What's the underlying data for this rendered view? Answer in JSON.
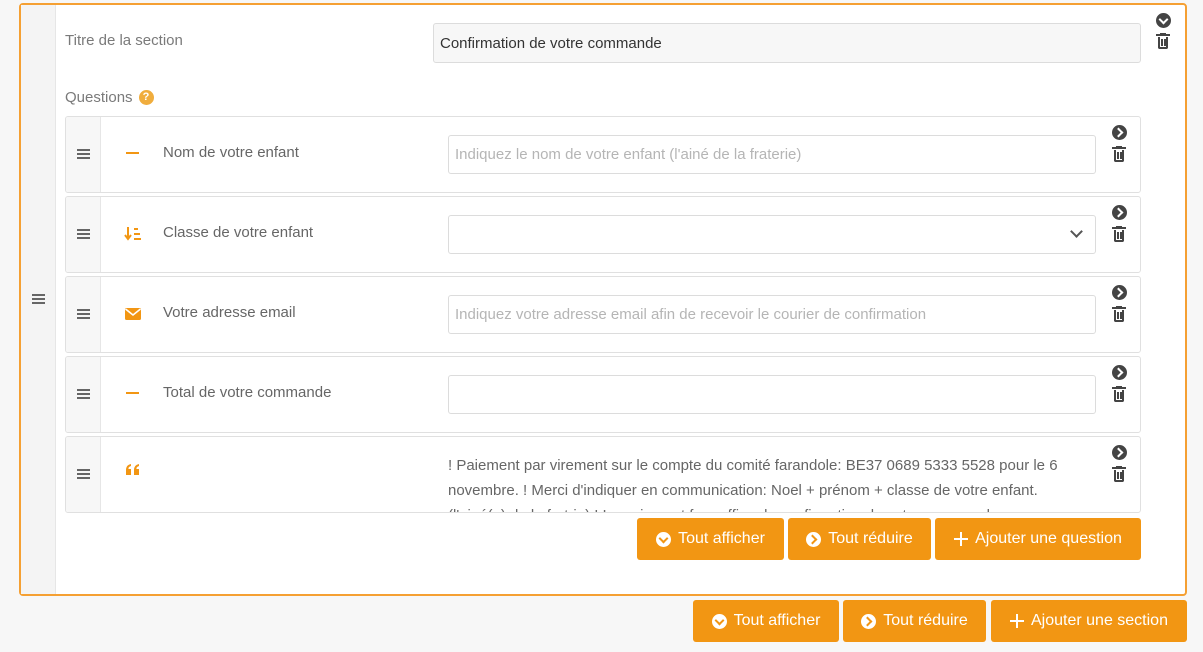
{
  "section": {
    "title_label": "Titre de la section",
    "title_value": "Confirmation de votre commande",
    "questions_label": "Questions",
    "help_icon": "?"
  },
  "questions": [
    {
      "label": "Nom de votre enfant",
      "type_icon": "minus-icon",
      "placeholder": "Indiquez le nom de votre enfant (l'ainé de la fraterie)",
      "value": ""
    },
    {
      "label": "Classe de votre enfant",
      "type_icon": "sort-list-icon",
      "value": ""
    },
    {
      "label": "Votre adresse email",
      "type_icon": "envelope-icon",
      "placeholder": "Indiquez votre adresse email afin de recevoir le courier de confirmation",
      "value": ""
    },
    {
      "label": "Total de votre commande",
      "type_icon": "minus-icon",
      "placeholder": "",
      "value": ""
    },
    {
      "label": "",
      "type_icon": "quote-icon",
      "text": "! Paiement par virement sur le compte du comité farandole: BE37 0689 5333 5528 pour le 6 novembre. ! Merci d'indiquer en communication: Noel + prénom + classe de votre enfant. (l'ainé(e) de la fratrie) ! Le paiement fera office de confirmation de votre commande."
    }
  ],
  "question_buttons": {
    "show_all": "Tout afficher",
    "collapse_all": "Tout réduire",
    "add_question": "Ajouter une question"
  },
  "section_buttons": {
    "show_all": "Tout afficher",
    "collapse_all": "Tout réduire",
    "add_section": "Ajouter une section"
  },
  "colors": {
    "accent": "#f29613",
    "border_accent": "#f5a033"
  }
}
